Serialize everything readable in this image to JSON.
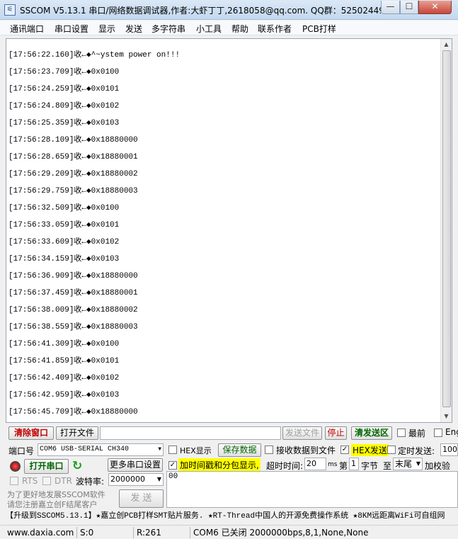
{
  "window": {
    "title": "SSCOM V5.13.1 串口/网络数据调试器,作者:大虾丁丁,2618058@qq.com. QQ群：52502449(最新版本)",
    "app_icon": "⚟",
    "min_glyph": "—",
    "max_glyph": "☐",
    "close_glyph": "✕"
  },
  "menu": [
    "通讯端口",
    "串口设置",
    "显示",
    "发送",
    "多字符串",
    "小工具",
    "帮助",
    "联系作者",
    "PCB打样"
  ],
  "receive": {
    "lines": [
      "[17:56:22.160]收←◆^~ystem power on!!!",
      "[17:56:23.709]收←◆0x0100",
      "[17:56:24.259]收←◆0x0101",
      "[17:56:24.809]收←◆0x0102",
      "[17:56:25.359]收←◆0x0103",
      "[17:56:28.109]收←◆0x18880000",
      "[17:56:28.659]收←◆0x18880001",
      "[17:56:29.209]收←◆0x18880002",
      "[17:56:29.759]收←◆0x18880003",
      "[17:56:32.509]收←◆0x0100",
      "[17:56:33.059]收←◆0x0101",
      "[17:56:33.609]收←◆0x0102",
      "[17:56:34.159]收←◆0x0103",
      "[17:56:36.909]收←◆0x18880000",
      "[17:56:37.459]收←◆0x18880001",
      "[17:56:38.009]收←◆0x18880002",
      "[17:56:38.559]收←◆0x18880003",
      "[17:56:41.309]收←◆0x0100",
      "[17:56:41.859]收←◆0x0101",
      "[17:56:42.409]收←◆0x0102",
      "[17:56:42.959]收←◆0x0103",
      "[17:56:45.709]收←◆0x18880000"
    ],
    "scroll_up": "▲",
    "scroll_down": "▼"
  },
  "toolbar": {
    "clear_window": "清除窗口",
    "open_file": "打开文件",
    "file_path": "",
    "send_file": "发送文件",
    "stop": "停止",
    "clear_send": "清发送区",
    "topmost": "最前",
    "english": "English"
  },
  "port": {
    "label": "端口号",
    "value": "COM6 USB-SERIAL CH340",
    "open_button": "打开串口",
    "refresh_icon": "↻",
    "more_settings": "更多串口设置",
    "rts": "RTS",
    "dtr": "DTR",
    "baud_label": "波特率:",
    "baud_value": "2000000",
    "dropdown_glyph": "▼"
  },
  "options": {
    "hex_display": "HEX显示",
    "save_data": "保存数据",
    "recv_to_file": "接收数据到文件",
    "hex_send": "HEX发送",
    "hex_send_checked": "✓",
    "timed_send": "定时发送:",
    "timed_value": "100",
    "timestamp": "加时间戳和分包显示,",
    "timestamp_checked": "✓",
    "timeout_label": "超时时间:",
    "timeout_value": "20",
    "ms": "ms",
    "nth": "第",
    "byte_index": "1",
    "byte_label": "字节",
    "to_label": "至",
    "tail_value": "末尾",
    "checksum_label": "加校验"
  },
  "send": {
    "button": "发  送",
    "text": "00"
  },
  "promo": {
    "line1": "为了更好地发展SSCOM软件",
    "line2": "请您注册嘉立创F结尾客户"
  },
  "ad_text": "【升级到SSCOM5.13.1】★嘉立创PCB打样SMT贴片服务. ★RT-Thread中国人的开源免费操作系统 ★8KM远距离WiFi可自组网",
  "status": {
    "website": "www.daxia.com",
    "sent": "S:0",
    "received": "R:261",
    "port_state": "COM6 已关闭  2000000bps,8,1,None,None"
  },
  "colors": {
    "clear_text": "#c00000",
    "open_text": "#006600",
    "stop_text": "#c00000",
    "highlight": "#ffff00",
    "save_text": "#006600"
  }
}
